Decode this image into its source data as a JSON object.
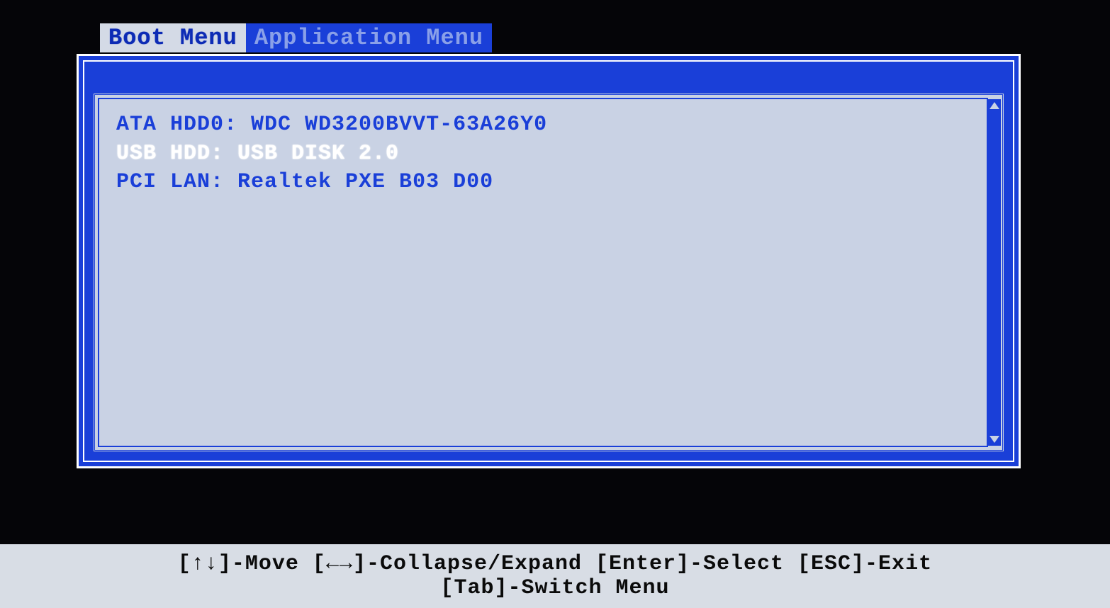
{
  "tabs": [
    {
      "label": "Boot Menu",
      "active": true
    },
    {
      "label": "Application Menu",
      "active": false
    }
  ],
  "boot_items": [
    {
      "label": "ATA HDD0: WDC WD3200BVVT-63A26Y0",
      "selected": false
    },
    {
      "label": "USB HDD: USB DISK 2.0",
      "selected": true
    },
    {
      "label": "PCI LAN: Realtek PXE B03 D00",
      "selected": false
    }
  ],
  "footer": {
    "line1": "[↑↓]-Move [←→]-Collapse/Expand [Enter]-Select [ESC]-Exit",
    "line2": "[Tab]-Switch Menu"
  }
}
